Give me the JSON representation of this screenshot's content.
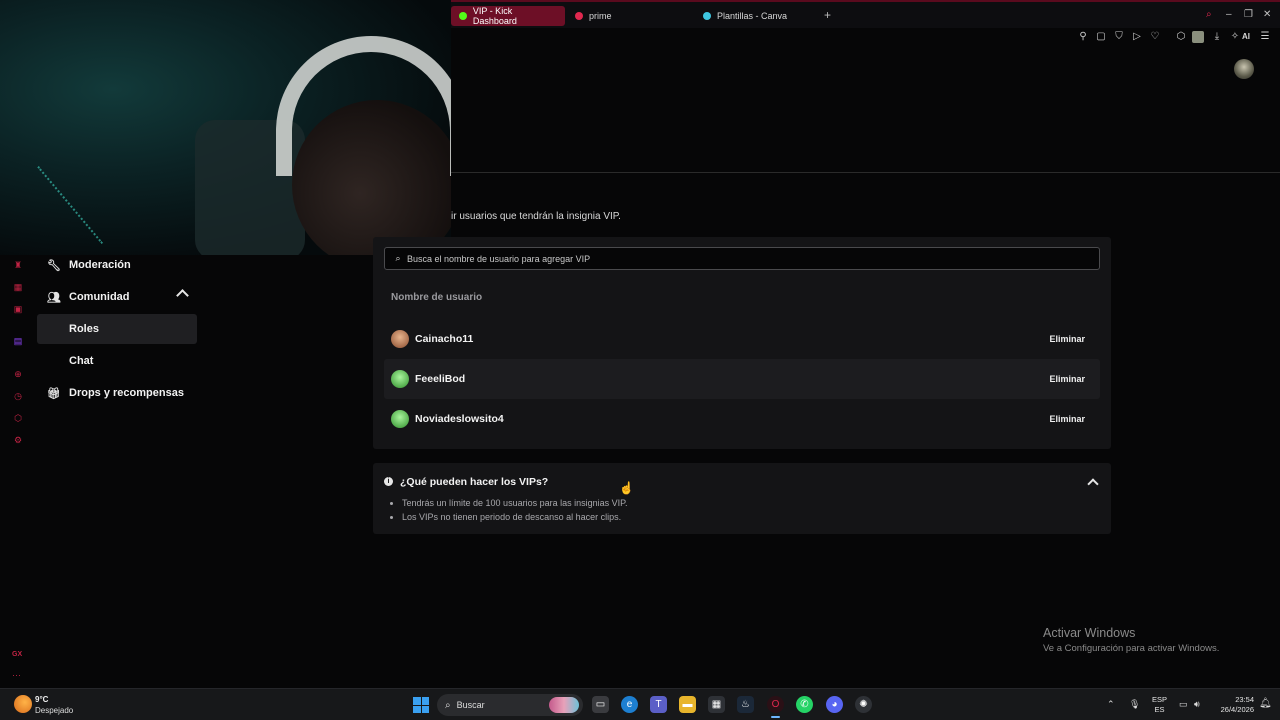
{
  "browser": {
    "tabs": [
      {
        "label": "VIP - Kick Dashboard",
        "active": true,
        "favicon_color": "#53fc18"
      },
      {
        "label": "prime",
        "active": false,
        "favicon_color": "#e0284f"
      },
      {
        "label": "Plantillas - Canva",
        "active": false,
        "favicon_color": "#3ec6e0"
      }
    ],
    "new_tab_label": "+",
    "toolbar_ai_label": "AI",
    "accent_color": "#6d0f26"
  },
  "page": {
    "intro_text": "ir usuarios que tendrán la insignia VIP."
  },
  "sidebar": {
    "items": [
      {
        "label": "Moderación",
        "icon": "wrench-icon"
      },
      {
        "label": "Comunidad",
        "icon": "users-icon"
      },
      {
        "label": "Roles",
        "icon": ""
      },
      {
        "label": "Chat",
        "icon": ""
      },
      {
        "label": "Drops y recompensas",
        "icon": "gift-icon"
      }
    ]
  },
  "vip": {
    "search_placeholder": "Busca el nombre de usuario para agregar VIP",
    "column_header": "Nombre de usuario",
    "remove_label": "Eliminar",
    "users": [
      {
        "name": "Cainacho11",
        "avatar_color": "#c0794f"
      },
      {
        "name": "FeeeliBod",
        "avatar_color": "#4fc94a"
      },
      {
        "name": "Noviadeslowsito4",
        "avatar_color": "#4fc94a"
      }
    ]
  },
  "faq": {
    "title": "¿Qué pueden hacer los VIPs?",
    "points": [
      "Tendrás un límite de 100 usuarios para las insignias VIP.",
      "Los VIPs no tienen periodo de descanso al hacer clips."
    ]
  },
  "watermark": {
    "line1": "Activar Windows",
    "line2": "Ve a Configuración para activar Windows."
  },
  "taskbar": {
    "weather_temp": "9°C",
    "weather_desc": "Despejado",
    "search_label": "Buscar",
    "lang_line1": "ESP",
    "lang_line2": "ES",
    "time": "23:54",
    "date": "26/4/2026"
  }
}
